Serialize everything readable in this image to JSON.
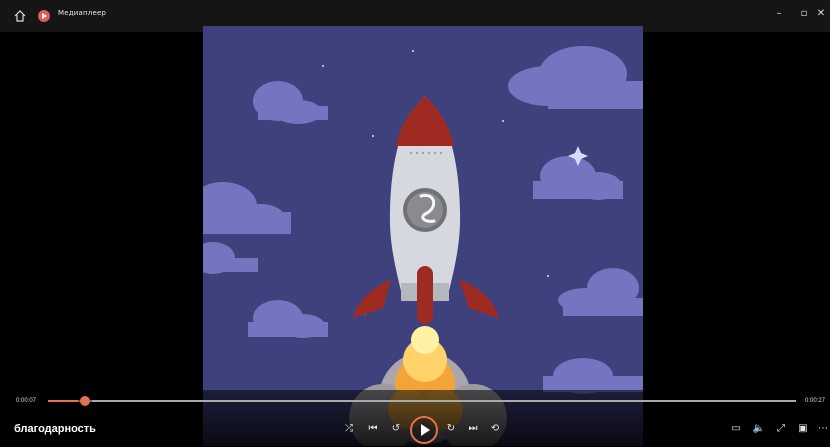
{
  "titlebar": {
    "title": "Медиаплеер",
    "icons": {
      "home": "home-icon",
      "app": "media-player-icon"
    },
    "window_controls": {
      "minimize": "–",
      "restore": "▫",
      "close": "✕"
    }
  },
  "player": {
    "time_elapsed": "0:00:07",
    "time_total": "0:00:27",
    "progress_fraction": 0.05,
    "track_title": "благодарность"
  },
  "controls": {
    "shuffle_icon": "shuffle-icon",
    "previous_icon": "previous-icon",
    "skip_back_icon": "skip-back-10-icon",
    "play_icon": "play-icon",
    "skip_forward_icon": "skip-forward-30-icon",
    "next_icon": "next-icon",
    "repeat_icon": "repeat-icon",
    "right": [
      "caption-icon",
      "volume-icon",
      "fullscreen-icon",
      "miniplayer-icon",
      "more-icon"
    ]
  },
  "colors": {
    "accent": "#e2714f",
    "sky": "#3f417c",
    "cloud": "#7474c1",
    "rocket": "#bfc1c8",
    "rocket_red": "#9f2a21"
  }
}
